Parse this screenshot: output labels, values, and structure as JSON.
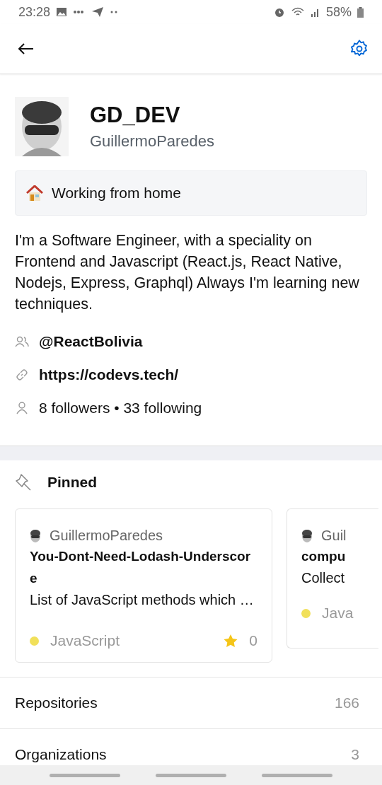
{
  "status_bar": {
    "time": "23:28",
    "battery": "58%"
  },
  "profile": {
    "display_name": "GD_DEV",
    "username": "GuillermoParedes",
    "status": "Working from home",
    "bio": "I'm a Software Engineer, with a speciality on Frontend and Javascript (React.js, React Native, Nodejs, Express, Graphql) Always I'm learning new techniques.",
    "details": [
      {
        "kind": "org",
        "text": "@ReactBolivia"
      },
      {
        "kind": "link",
        "text": "https://codevs.tech/"
      },
      {
        "kind": "people",
        "text": "8 followers • 33 following"
      }
    ]
  },
  "pinned": {
    "title": "Pinned",
    "repos": [
      {
        "owner": "GuillermoParedes",
        "name": "You-Dont-Need-Lodash-Underscore",
        "description": "List of JavaScript methods which …",
        "language": "JavaScript",
        "color": "#f1e05a",
        "stars": "0"
      },
      {
        "owner": "Guil",
        "name": "compu",
        "description": "Collect",
        "language": "Java",
        "color": "#f1e05a"
      }
    ]
  },
  "menu": [
    {
      "label": "Repositories",
      "count": "166"
    },
    {
      "label": "Organizations",
      "count": "3"
    }
  ]
}
